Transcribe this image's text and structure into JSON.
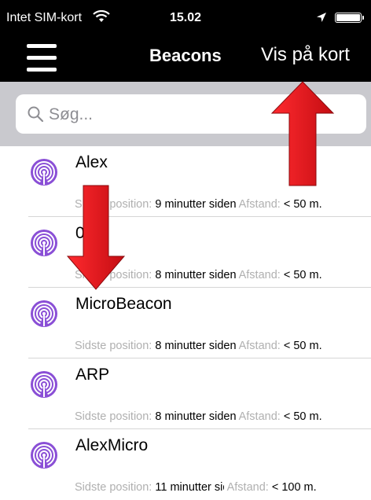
{
  "status_bar": {
    "carrier": "Intet SIM-kort",
    "time": "15.02"
  },
  "nav": {
    "title": "Beacons",
    "action": "Vis på kort"
  },
  "search": {
    "placeholder": "Søg..."
  },
  "beacons": [
    {
      "name": "Alex",
      "position_label": "Sidste position:",
      "position_value": "9 minutter siden",
      "distance_label": "Afstand:",
      "distance_value": "< 50 m."
    },
    {
      "name": "0   36",
      "position_label": "Sidste position:",
      "position_value": "8 minutter siden",
      "distance_label": "Afstand:",
      "distance_value": "< 50 m."
    },
    {
      "name": "MicroBeacon",
      "position_label": "Sidste position:",
      "position_value": "8 minutter siden",
      "distance_label": "Afstand:",
      "distance_value": "< 50 m."
    },
    {
      "name": "ARP",
      "position_label": "Sidste position:",
      "position_value": "8 minutter siden",
      "distance_label": "Afstand:",
      "distance_value": "< 50 m."
    },
    {
      "name": "AlexMicro",
      "position_label": "Sidste position:",
      "position_value": "11 minutter siden",
      "distance_label": "Afstand:",
      "distance_value": "< 100 m."
    }
  ],
  "colors": {
    "bar_background": "#000000",
    "search_background": "#c9c9ce",
    "beacon_icon": "#8a4fd6",
    "annotation_arrow": "#e0151b"
  },
  "icons": {
    "menu": "hamburger-menu-icon",
    "search": "magnifier-icon",
    "beacon": "beacon-signal-icon",
    "wifi": "wifi-icon",
    "location": "location-arrow-icon",
    "battery": "battery-icon"
  }
}
